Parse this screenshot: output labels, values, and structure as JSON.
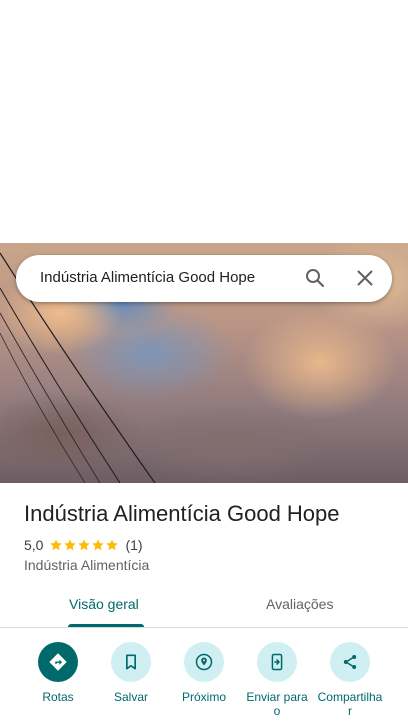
{
  "search": {
    "query": "Indústria Alimentícia Good Hope"
  },
  "place": {
    "title": "Indústria Alimentícia Good Hope",
    "rating": "5,0",
    "stars": 5,
    "review_count": "(1)",
    "category": "Indústria Alimentícia"
  },
  "tabs": [
    {
      "label": "Visão geral",
      "selected": true
    },
    {
      "label": "Avaliações",
      "selected": false
    }
  ],
  "actions": [
    {
      "label": "Rotas",
      "icon": "directions-icon"
    },
    {
      "label": "Salvar",
      "icon": "bookmark-icon"
    },
    {
      "label": "Próximo",
      "icon": "nearby-icon"
    },
    {
      "label": "Enviar para o",
      "icon": "send-to-phone-icon"
    },
    {
      "label": "Compartilha r",
      "icon": "share-icon"
    }
  ],
  "colors": {
    "accent": "#00696b",
    "action_bg": "#cfeff2",
    "star": "#fbbc04"
  }
}
